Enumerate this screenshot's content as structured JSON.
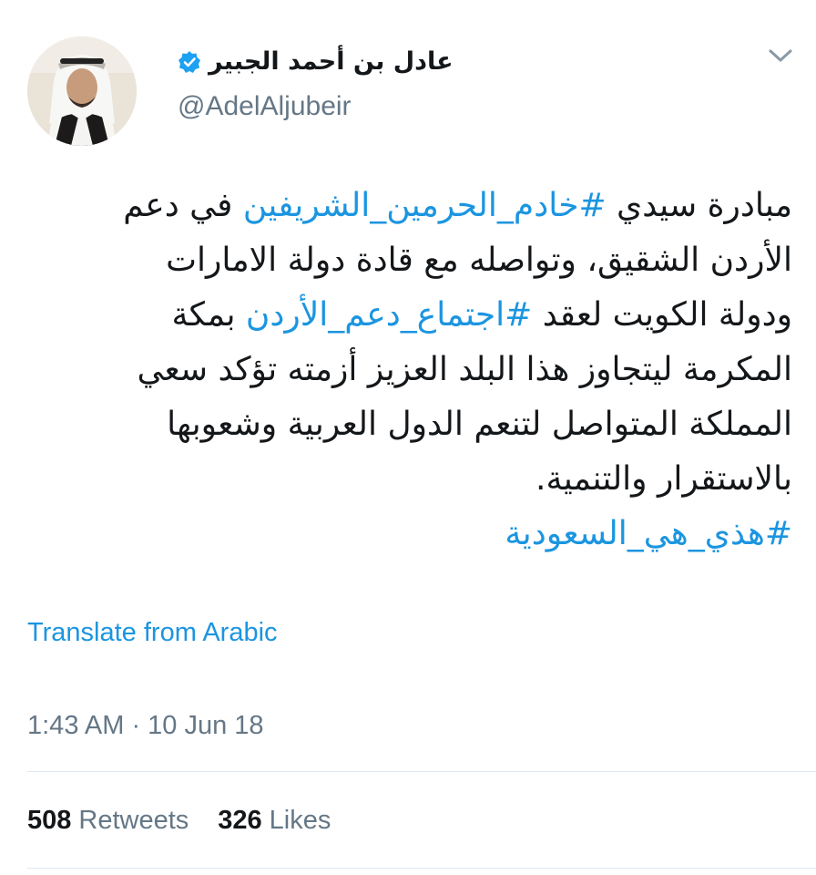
{
  "author": {
    "display_name": "عادل بن أحمد الجبير",
    "handle": "@AdelAljubeir",
    "verified": true,
    "avatar": "profile-photo"
  },
  "tweet": {
    "lines": [
      [
        {
          "text": "مبادرة سيدي ",
          "hashtag": false
        },
        {
          "text": "#خادم_الحرمين_الشريفين",
          "hashtag": true
        },
        {
          "text": " في دعم",
          "hashtag": false
        }
      ],
      [
        {
          "text": "الأردن الشقيق، وتواصله مع قادة دولة الامارات",
          "hashtag": false
        }
      ],
      [
        {
          "text": "ودولة الكويت لعقد ",
          "hashtag": false
        },
        {
          "text": "#اجتماع_دعم_الأردن",
          "hashtag": true
        },
        {
          "text": " بمكة",
          "hashtag": false
        }
      ],
      [
        {
          "text": "المكرمة ليتجاوز هذا البلد العزيز أزمته تؤكد سعي",
          "hashtag": false
        }
      ],
      [
        {
          "text": "المملكة المتواصل لتنعم الدول العربية وشعوبها",
          "hashtag": false
        }
      ],
      [
        {
          "text": "بالاستقرار والتنمية.",
          "hashtag": false
        }
      ],
      [
        {
          "text": "#هذي_هي_السعودية",
          "hashtag": true
        }
      ]
    ],
    "translate_label": "Translate from Arabic",
    "timestamp": "1:43 AM · 10 Jun 18"
  },
  "stats": {
    "retweets_count": "508",
    "retweets_label": "Retweets",
    "likes_count": "326",
    "likes_label": "Likes"
  },
  "colors": {
    "link": "#1b95e0",
    "text": "#14171a",
    "muted": "#657786",
    "divider": "#e1e8ed"
  },
  "icons": {
    "verified": "verified-badge-icon",
    "caret": "chevron-down-icon"
  }
}
